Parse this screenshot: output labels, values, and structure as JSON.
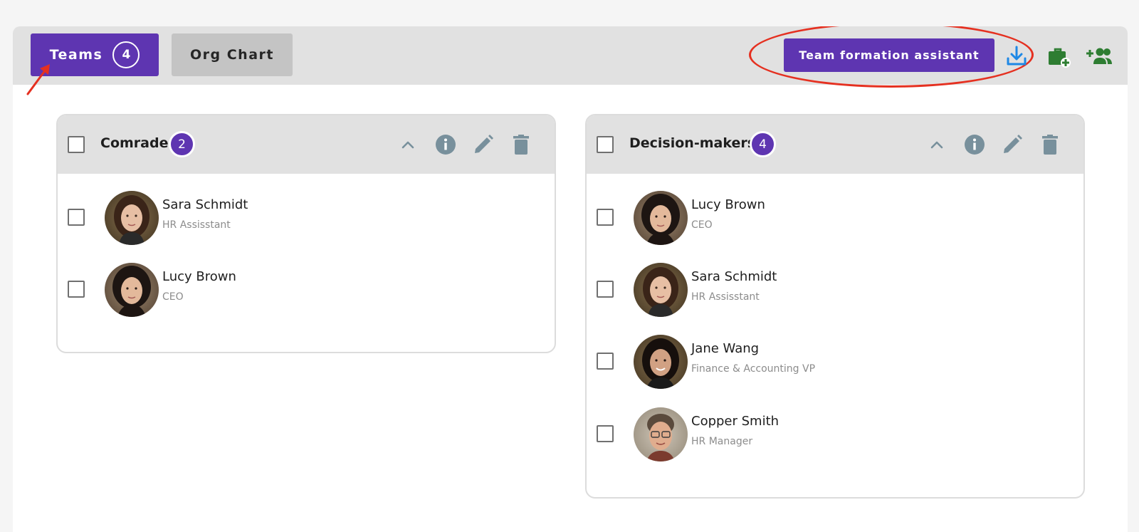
{
  "tabs": {
    "teams_label": "Teams",
    "teams_count": "4",
    "org_chart_label": "Org Chart"
  },
  "toolbar": {
    "assistant_label": "Team formation assistant",
    "icons": [
      "download-icon",
      "add-briefcase-icon",
      "add-group-icon"
    ]
  },
  "colors": {
    "accent": "#5e35b1",
    "download_icon": "#1e88e5",
    "green_icon": "#2e7d32",
    "annotation": "#e53020"
  },
  "teams": [
    {
      "name": "Comrade",
      "count": "2",
      "members": [
        {
          "name": "Sara Schmidt",
          "role": "HR Assisstant"
        },
        {
          "name": "Lucy Brown",
          "role": "CEO"
        }
      ]
    },
    {
      "name": "Decision-makers",
      "count": "4",
      "members": [
        {
          "name": "Lucy Brown",
          "role": "CEO"
        },
        {
          "name": "Sara Schmidt",
          "role": "HR Assisstant"
        },
        {
          "name": "Jane Wang",
          "role": "Finance & Accounting VP"
        },
        {
          "name": "Copper Smith",
          "role": "HR Manager"
        }
      ]
    }
  ]
}
